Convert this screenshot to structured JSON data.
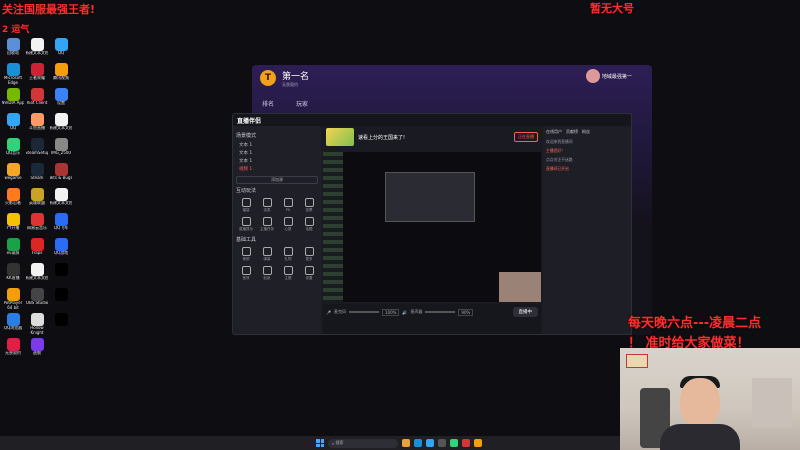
{
  "overlays": {
    "top_left_line1": "关注国服最强王者!",
    "top_left_line2": "2 运气",
    "top_right": "暂无大号",
    "schedule_line1": "每天晚六点---凌晨二点",
    "schedule_line2": "！ 准时给大家做菜！"
  },
  "desktop_icons": [
    {
      "label": "回收站",
      "color": "#5d8fd6"
    },
    {
      "label": "新建文本文档",
      "color": "#f2f2f2"
    },
    {
      "label": "QQ",
      "color": "#30a6f5"
    },
    {
      "label": "Microsoft Edge",
      "color": "#1a8fd6"
    },
    {
      "label": "王者荣耀",
      "color": "#c23"
    },
    {
      "label": "腾讯视频",
      "color": "#f59e0b"
    },
    {
      "label": "NVIDIA App",
      "color": "#76b900"
    },
    {
      "label": "Riot Client",
      "color": "#d13639"
    },
    {
      "label": "设置",
      "color": "#3b82f6"
    },
    {
      "label": "QQ",
      "color": "#30a6f5"
    },
    {
      "label": "斗鱼直播",
      "color": "#f96"
    },
    {
      "label": "新建文本文档",
      "color": "#f2f2f2"
    },
    {
      "label": "QQ音乐",
      "color": "#2fd37a"
    },
    {
      "label": "SteamSetup",
      "color": "#1b2838"
    },
    {
      "label": "IMG_2500",
      "color": "#888"
    },
    {
      "label": "wegame",
      "color": "#f5a623"
    },
    {
      "label": "Steam",
      "color": "#1b2838"
    },
    {
      "label": "Bits & Bugs",
      "color": "#a33"
    },
    {
      "label": "火影忍者",
      "color": "#ff7a1a"
    },
    {
      "label": "英雄联盟",
      "color": "#c9a227"
    },
    {
      "label": "新建文本文档",
      "color": "#f2f2f2"
    },
    {
      "label": "YY开播",
      "color": "#f7c200"
    },
    {
      "label": "网易云音乐",
      "color": "#d33"
    },
    {
      "label": "QQ飞车",
      "color": "#2a6df4"
    },
    {
      "label": "ev录屏",
      "color": "#16a34a"
    },
    {
      "label": "Fraps",
      "color": "#dc2626"
    },
    {
      "label": "QQ游戏",
      "color": "#2a6df4"
    },
    {
      "label": "KK直播",
      "color": "#333"
    },
    {
      "label": "新建文本文档",
      "color": "#f2f2f2"
    },
    {
      "label": "",
      "color": "#000"
    },
    {
      "label": "PotPlayer 64 bit",
      "color": "#f59e0b"
    },
    {
      "label": "OBS Studio",
      "color": "#444"
    },
    {
      "label": "",
      "color": "#000"
    },
    {
      "label": "QQ浏览器",
      "color": "#2a7de1"
    },
    {
      "label": "Hollow Knight",
      "color": "#ddd"
    },
    {
      "label": "",
      "color": "#000"
    },
    {
      "label": "无畏契约",
      "color": "#e11d48"
    },
    {
      "label": "逃脱",
      "color": "#7c3aed"
    }
  ],
  "leaderboard": {
    "badge": "T",
    "title": "第一名",
    "subtitle": "无畏契约",
    "col_rank": "排名",
    "col_player": "玩家",
    "username": "地域最强第一"
  },
  "app": {
    "name": "直播伴侣",
    "version": "",
    "scene_section": "场景模式",
    "scenes": [
      "文本 1",
      "文本 1",
      "文本 1",
      "视频 1"
    ],
    "add_button": "添加源",
    "interaction_section": "互动玩法",
    "tools_row1": [
      "福袋",
      "连麦",
      "PK",
      "投票"
    ],
    "tools_row2": [
      "直播提示",
      "主播任务",
      "心愿",
      "话题"
    ],
    "basic_section": "基础工具",
    "tools_row3": [
      "美颜",
      "弹幕",
      "礼物",
      "更多"
    ],
    "tools_row4": [
      "音效",
      "贴纸",
      "主题",
      "设置"
    ],
    "stream_title": "速看上分的王国来了!",
    "live_label": "正在直播",
    "mic_label": "麦克风",
    "mic_pct": "100%",
    "speaker_label": "扬声器",
    "speaker_pct": "90%",
    "go_live": "直播中",
    "chat_tabs": [
      "在线用户",
      "贡献榜",
      "粉丝"
    ],
    "chat_lines": [
      "欢迎来到直播间",
      "主播您好！",
      "点点关注不迷路",
      "直播间已开启"
    ]
  },
  "chatwin": {
    "tabs": [
      "在线用户",
      "贡献榜",
      "粉丝"
    ],
    "messages": [
      "欢迎来到直播间，请遵守平台规则",
      "点击关注主播",
      "主播技术好",
      "每天晚上都在"
    ],
    "send": "发送"
  },
  "taskbar": {
    "search_placeholder": "搜索"
  }
}
